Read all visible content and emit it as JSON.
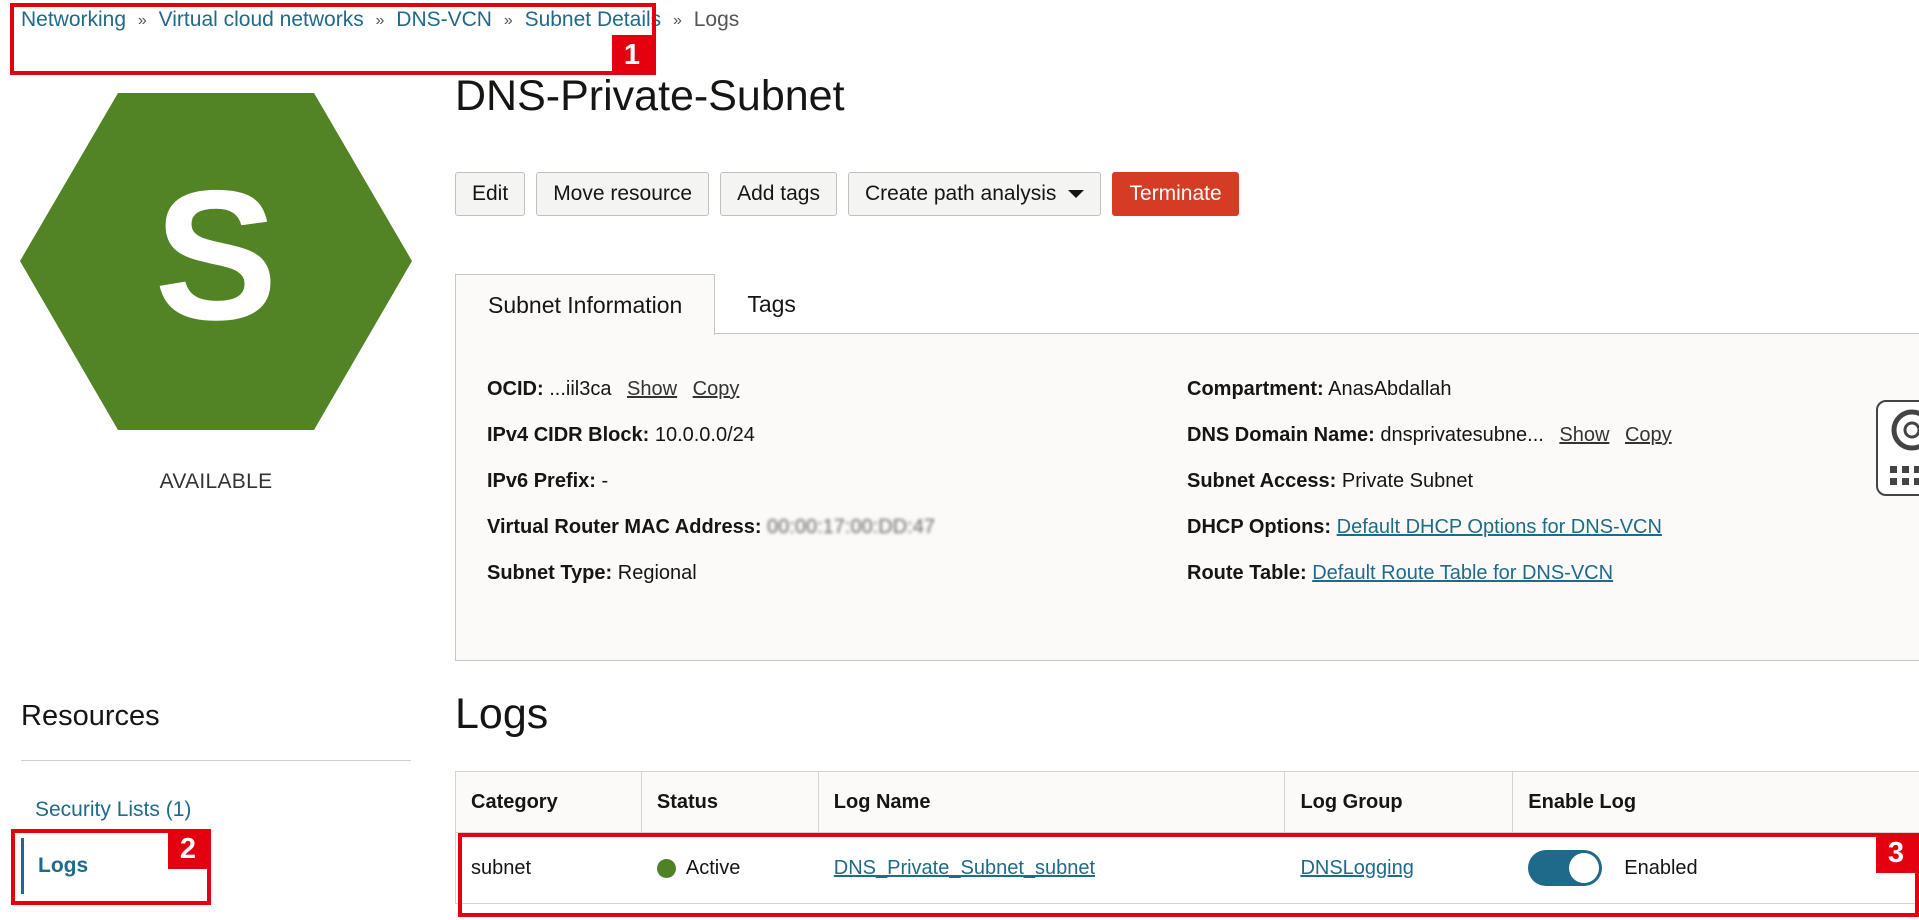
{
  "breadcrumb": {
    "items": [
      "Networking",
      "Virtual cloud networks",
      "DNS-VCN",
      "Subnet Details"
    ],
    "current": "Logs",
    "separator": "»"
  },
  "annotations": [
    "1",
    "2",
    "3"
  ],
  "resource_icon": {
    "letter": "S",
    "color": "#528426",
    "state": "AVAILABLE"
  },
  "page_title": "DNS-Private-Subnet",
  "actions": {
    "edit": "Edit",
    "move": "Move resource",
    "add_tags": "Add tags",
    "path_analysis": "Create path analysis",
    "terminate": "Terminate"
  },
  "tabs": [
    "Subnet Information",
    "Tags"
  ],
  "subnet_info": {
    "ocid": {
      "label": "OCID:",
      "value": "...iil3ca",
      "show": "Show",
      "copy": "Copy"
    },
    "ipv4": {
      "label": "IPv4 CIDR Block:",
      "value": "10.0.0.0/24"
    },
    "ipv6": {
      "label": "IPv6 Prefix:",
      "value": "-"
    },
    "mac": {
      "label": "Virtual Router MAC Address:",
      "value": "00:00:17:00:DD:47"
    },
    "subnet_type": {
      "label": "Subnet Type:",
      "value": "Regional"
    },
    "compartment": {
      "label": "Compartment:",
      "value": "AnasAbdallah"
    },
    "dns_domain": {
      "label": "DNS Domain Name:",
      "value": "dnsprivatesubne...",
      "show": "Show",
      "copy": "Copy"
    },
    "access": {
      "label": "Subnet Access:",
      "value": "Private Subnet"
    },
    "dhcp": {
      "label": "DHCP Options:",
      "value": "Default DHCP Options for DNS-VCN"
    },
    "route_table": {
      "label": "Route Table:",
      "value": "Default Route Table for DNS-VCN"
    }
  },
  "resources": {
    "heading": "Resources",
    "items": [
      "Security Lists (1)",
      "Logs"
    ]
  },
  "logs": {
    "heading": "Logs",
    "columns": [
      "Category",
      "Status",
      "Log Name",
      "Log Group",
      "Enable Log"
    ],
    "rows": [
      {
        "category": "subnet",
        "status": "Active",
        "log_name": "DNS_Private_Subnet_subnet",
        "log_group": "DNSLogging",
        "enable_log": "Enabled"
      }
    ],
    "status_color": "#4f8225",
    "toggle_color": "#1f6a8a"
  },
  "colors": {
    "link": "#1f6a8a",
    "danger": "#d63b25",
    "annotation": "#e3000f"
  },
  "help_widget": {
    "icons": [
      "lifebuoy-icon",
      "grid-icon"
    ]
  }
}
